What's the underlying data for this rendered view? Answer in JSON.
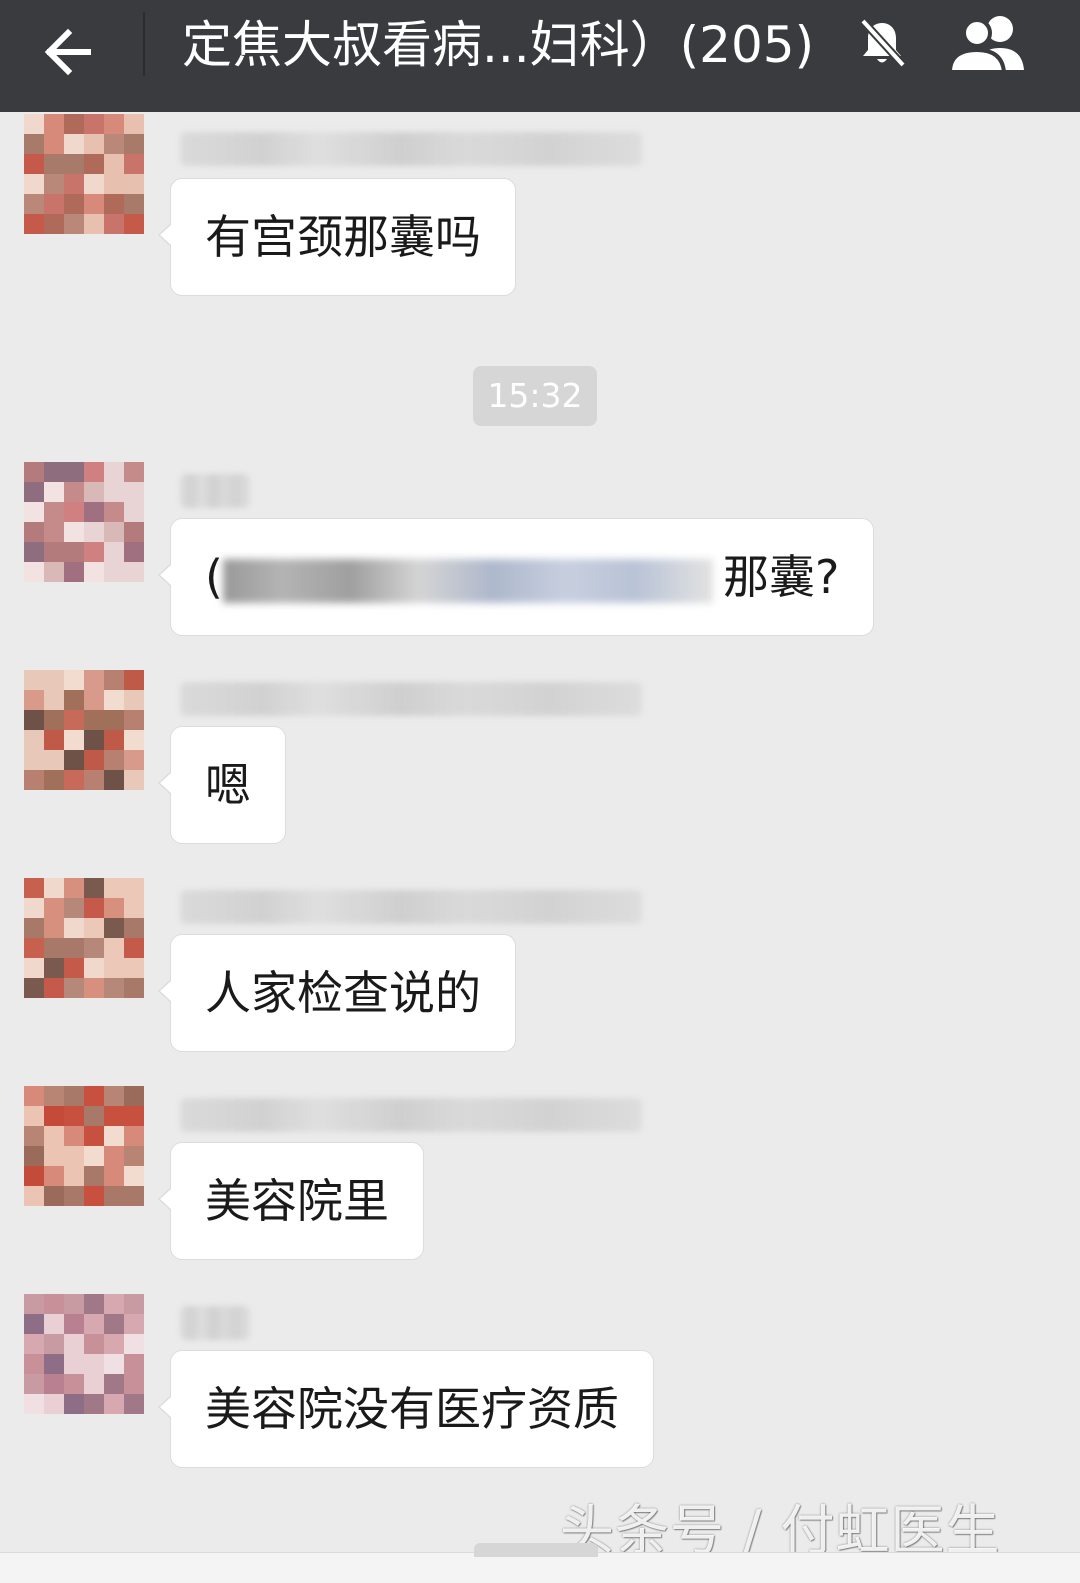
{
  "header": {
    "title": "定焦大叔看病...妇科）(205)",
    "back_icon": "arrow-left-icon",
    "mute_icon": "bell-off-icon",
    "members_icon": "group-icon"
  },
  "timestamp": "15:32",
  "messages": [
    {
      "text": "有宫颈那囊吗"
    },
    {
      "prefix": "(",
      "suffix": "那囊?"
    },
    {
      "text": "嗯"
    },
    {
      "text": "人家检查说的"
    },
    {
      "text": "美容院里"
    },
    {
      "text": "美容院没有医疗资质"
    }
  ],
  "watermark": "头条号 / 付虹医生",
  "colors": {
    "topbar": "#3a3b3f",
    "background": "#ebebeb",
    "bubble": "#ffffff"
  }
}
